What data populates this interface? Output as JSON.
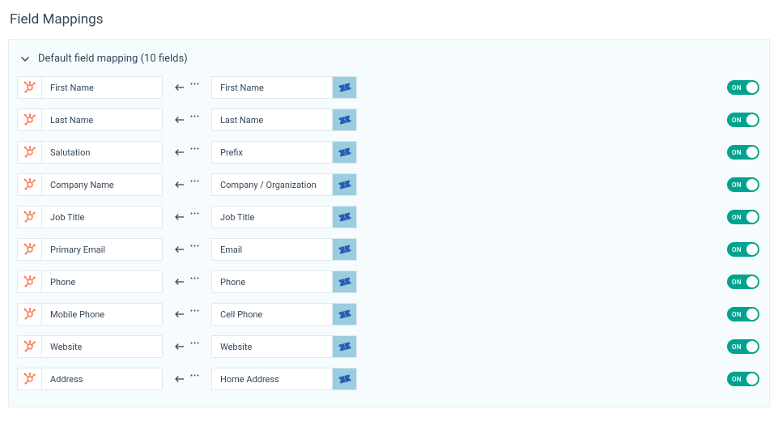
{
  "page_title": "Field Mappings",
  "section": {
    "title": "Default field mapping (10 fields)",
    "mappings": [
      {
        "left_field": "First Name",
        "right_field": "First Name",
        "arrow": "left",
        "toggle": "ON"
      },
      {
        "left_field": "Last Name",
        "right_field": "Last Name",
        "arrow": "left",
        "toggle": "ON"
      },
      {
        "left_field": "Salutation",
        "right_field": "Prefix",
        "arrow": "left",
        "toggle": "ON"
      },
      {
        "left_field": "Company Name",
        "right_field": "Company / Organization",
        "arrow": "left",
        "toggle": "ON"
      },
      {
        "left_field": "Job Title",
        "right_field": "Job Title",
        "arrow": "left",
        "toggle": "ON"
      },
      {
        "left_field": "Primary Email",
        "right_field": "Email",
        "arrow": "left",
        "toggle": "ON"
      },
      {
        "left_field": "Phone",
        "right_field": "Phone",
        "arrow": "left",
        "toggle": "ON"
      },
      {
        "left_field": "Mobile Phone",
        "right_field": "Cell Phone",
        "arrow": "left",
        "toggle": "ON"
      },
      {
        "left_field": "Website",
        "right_field": "Website",
        "arrow": "left",
        "toggle": "ON"
      },
      {
        "left_field": "Address",
        "right_field": "Home Address",
        "arrow": "left",
        "toggle": "ON"
      }
    ]
  },
  "icons": {
    "left_provider": "hubspot-icon",
    "right_provider": "ticket-icon"
  },
  "colors": {
    "hubspot_orange": "#ff7a59",
    "right_icon_bg": "#9acde0",
    "ticket_blue": "#265fb5",
    "toggle_on": "#00a38d",
    "panel_bg": "#f6fbfd",
    "border": "#dfe9ee",
    "text": "#33475b"
  }
}
